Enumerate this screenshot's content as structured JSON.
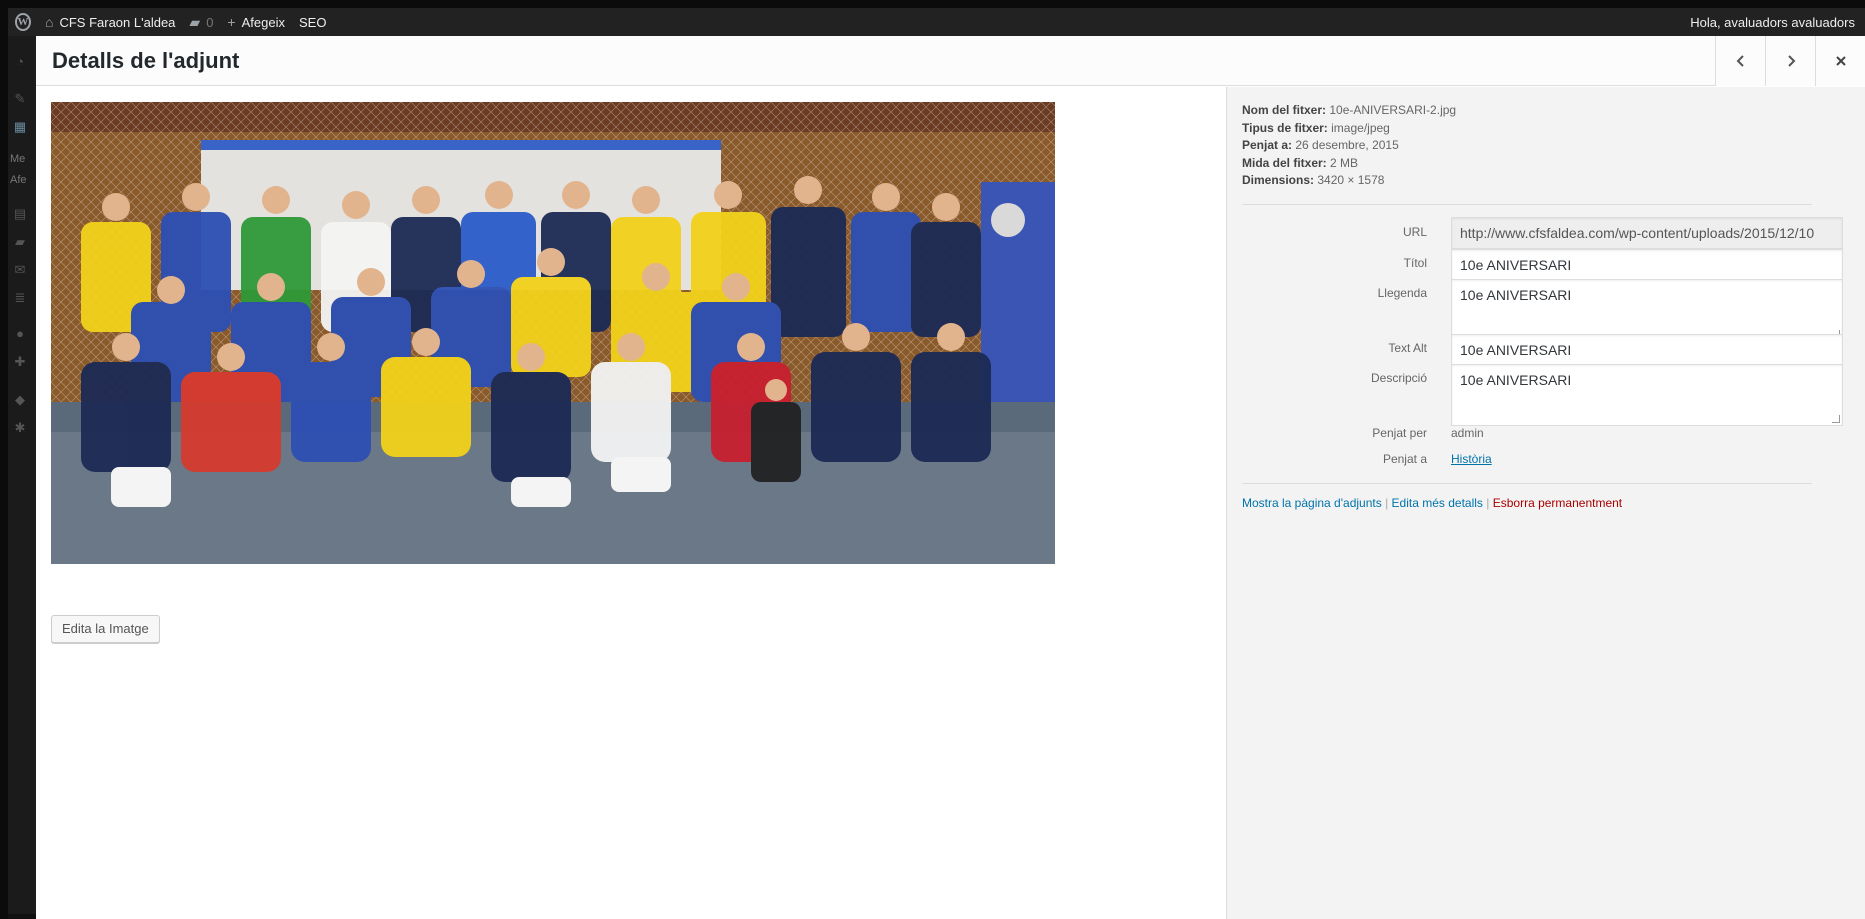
{
  "adminbar": {
    "site_name": "CFS Faraon L'aldea",
    "comments_count": "0",
    "new_label": "Afegeix",
    "seo_label": "SEO",
    "greeting": "Hola, avaluadors avaluadors"
  },
  "adminmenu": {
    "text1": "Me",
    "text2": "Afe"
  },
  "modal": {
    "title": "Detalls de l'adjunt",
    "edit_image_label": "Edita la Imatge"
  },
  "details": {
    "meta": {
      "filename_label": "Nom del fitxer:",
      "filename": "10e-ANIVERSARI-2.jpg",
      "filetype_label": "Tipus de fitxer:",
      "filetype": "image/jpeg",
      "uploaded_label": "Penjat a:",
      "uploaded": "26 desembre, 2015",
      "size_label": "Mida del fitxer:",
      "size": "2 MB",
      "dimensions_label": "Dimensions:",
      "dimensions": "3420 × 1578"
    },
    "url_label": "URL",
    "url_value": "http://www.cfsfaldea.com/wp-content/uploads/2015/12/10",
    "title_label": "Títol",
    "title_value": "10e ANIVERSARI",
    "caption_label": "Llegenda",
    "caption_value": "10e ANIVERSARI",
    "alt_label": "Text Alt",
    "alt_value": "10e ANIVERSARI",
    "description_label": "Descripció",
    "description_value": "10e ANIVERSARI",
    "uploaded_by_label": "Penjat per",
    "uploaded_by": "admin",
    "uploaded_to_label": "Penjat a",
    "uploaded_to": "Història",
    "view_page": "Mostra la pàgina d'adjunts",
    "edit_more": "Edita més detalls",
    "delete": "Esborra permanentment",
    "separator": "|"
  },
  "colors": {
    "accent_link": "#0073aa",
    "delete": "#a00000",
    "adminbar_bg": "#222222"
  },
  "icons": {
    "prev": "chevron-left-icon",
    "next": "chevron-right-icon",
    "close": "close-icon"
  }
}
